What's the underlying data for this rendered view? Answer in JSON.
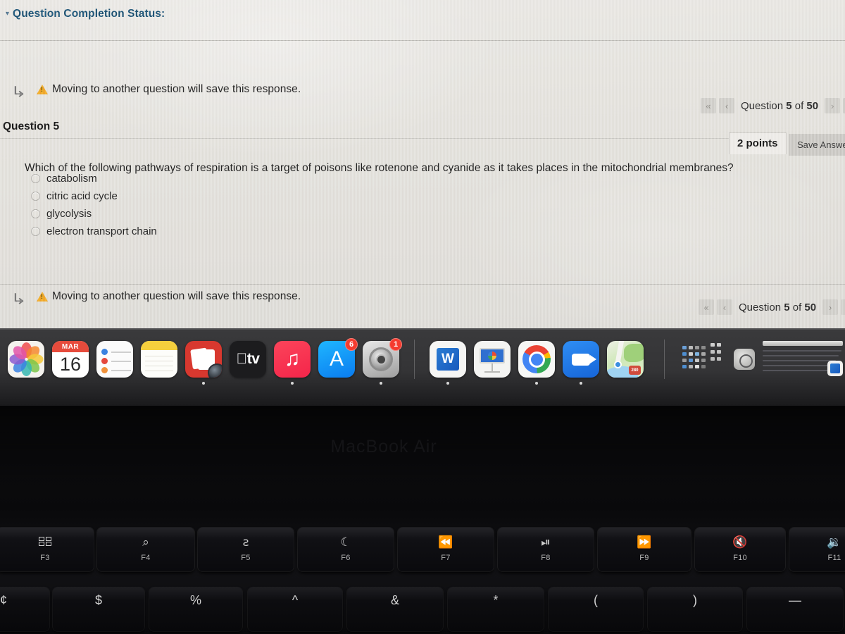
{
  "screen": {
    "status_header": {
      "caret": "▾",
      "label": "Question Completion Status:"
    },
    "warning": {
      "arrow_icon": "↳",
      "icon": "warning-triangle-icon",
      "text": "Moving to another question will save this response."
    },
    "nav": {
      "first_label": "«",
      "prev_label": "‹",
      "next_label": "›",
      "last_label": "»",
      "counter_prefix": "Question ",
      "current": "5",
      "counter_middle": " of ",
      "total": "50"
    },
    "question": {
      "title": "Question 5",
      "points": "2 points",
      "save_label": "Save Answer",
      "text": "Which of the following pathways of respiration is a target of poisons like rotenone and cyanide as it takes places in the mitochondrial membranes?",
      "options": [
        {
          "label": "catabolism",
          "selected": false
        },
        {
          "label": "citric acid cycle",
          "selected": false
        },
        {
          "label": "glycolysis",
          "selected": false
        },
        {
          "label": "electron transport chain",
          "selected": false
        }
      ]
    }
  },
  "dock": {
    "items": [
      {
        "name": "photos",
        "label": "Photos",
        "running": false
      },
      {
        "name": "calendar",
        "label": "Calendar",
        "month": "MAR",
        "day": "16",
        "running": false
      },
      {
        "name": "reminders",
        "label": "Reminders",
        "running": false
      },
      {
        "name": "notes",
        "label": "Notes",
        "running": false
      },
      {
        "name": "photo-booth",
        "label": "Photo Booth",
        "running": true
      },
      {
        "name": "apple-tv",
        "label": "tv",
        "running": false
      },
      {
        "name": "music",
        "label": "Music",
        "glyph": "♫",
        "running": true
      },
      {
        "name": "app-store",
        "label": "App Store",
        "glyph": "A",
        "badge": "6",
        "running": false
      },
      {
        "name": "system-preferences",
        "label": "System Preferences",
        "badge": "1",
        "running": true
      },
      {
        "name": "microsoft-word",
        "label": "Word",
        "glyph": "W",
        "running": true
      },
      {
        "name": "keynote",
        "label": "Keynote",
        "running": false
      },
      {
        "name": "google-chrome",
        "label": "Chrome",
        "running": true
      },
      {
        "name": "zoom",
        "label": "Zoom",
        "running": true
      },
      {
        "name": "maps",
        "label": "Maps",
        "running": false
      }
    ],
    "stacks": [
      {
        "name": "launchpad-grid",
        "label": "Launchpad"
      },
      {
        "name": "finder-stack",
        "label": "Finder"
      },
      {
        "name": "documents-stack",
        "label": "Documents"
      }
    ]
  },
  "laptop": {
    "logo": "MacBook Air",
    "function_keys": [
      {
        "key": "F3",
        "icon": "mission-control-icon",
        "glyph": ""
      },
      {
        "key": "F4",
        "icon": "spotlight-search-icon",
        "glyph": "⌕"
      },
      {
        "key": "F5",
        "icon": "dictation-microphone-icon",
        "glyph": "ƨ"
      },
      {
        "key": "F6",
        "icon": "do-not-disturb-moon-icon",
        "glyph": "☾"
      },
      {
        "key": "F7",
        "icon": "rewind-icon",
        "glyph": "⏪"
      },
      {
        "key": "F8",
        "icon": "play-pause-icon",
        "glyph": "⏯"
      },
      {
        "key": "F9",
        "icon": "fast-forward-icon",
        "glyph": "⏩"
      },
      {
        "key": "F10",
        "icon": "mute-volume-icon",
        "glyph": "🔇"
      },
      {
        "key": "F11",
        "icon": "volume-down-icon",
        "glyph": "🔉"
      }
    ],
    "number_row": [
      "¢",
      "$",
      "%",
      "^",
      "&",
      "*",
      "(",
      ")",
      "—"
    ]
  },
  "colors": {
    "screen_bg": "#e4e2dd",
    "header_blue": "#1d4f6e",
    "warning_orange": "#f0a32a",
    "dock_bg": "#343436",
    "badge_red": "#f53b2f",
    "keyboard_black": "#0a0a0c"
  }
}
